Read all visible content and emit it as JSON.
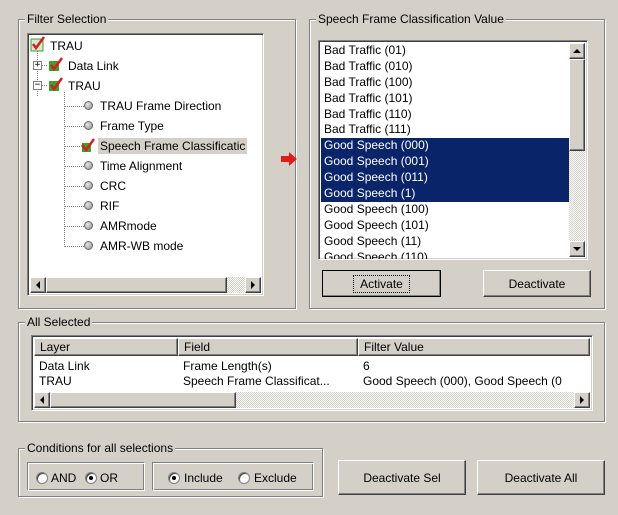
{
  "filter_selection": {
    "title": "Filter Selection",
    "tree": {
      "root": "TRAU",
      "data_link": "Data Link",
      "trau": "TRAU",
      "children": [
        "TRAU Frame Direction",
        "Frame Type",
        "Speech Frame Classificatic",
        "Time Alignment",
        "CRC",
        "RIF",
        "AMRmode",
        "AMR-WB mode"
      ],
      "selected_index": 2,
      "expand_plus": "+",
      "expand_minus": "−"
    }
  },
  "value_panel": {
    "title": "Speech Frame Classification Value",
    "items": [
      {
        "label": "Bad Traffic (01)",
        "selected": false
      },
      {
        "label": "Bad Traffic (010)",
        "selected": false
      },
      {
        "label": "Bad Traffic (100)",
        "selected": false
      },
      {
        "label": "Bad Traffic (101)",
        "selected": false
      },
      {
        "label": "Bad Traffic (110)",
        "selected": false
      },
      {
        "label": "Bad Traffic (111)",
        "selected": false
      },
      {
        "label": "Good Speech (000)",
        "selected": true
      },
      {
        "label": "Good Speech (001)",
        "selected": true
      },
      {
        "label": "Good Speech (011)",
        "selected": true
      },
      {
        "label": "Good Speech (1)",
        "selected": true
      },
      {
        "label": "Good Speech (100)",
        "selected": false
      },
      {
        "label": "Good Speech (101)",
        "selected": false
      },
      {
        "label": "Good Speech (11)",
        "selected": false
      },
      {
        "label": "Good Speech (110)",
        "selected": false
      }
    ],
    "activate_label": "Activate",
    "deactivate_label": "Deactivate"
  },
  "all_selected": {
    "title": "All Selected",
    "columns": [
      "Layer",
      "Field",
      "Filter Value"
    ],
    "rows": [
      [
        "Data Link",
        "Frame Length(s)",
        "6"
      ],
      [
        "TRAU",
        "Speech Frame Classificat...",
        "Good Speech (000), Good Speech (0"
      ]
    ]
  },
  "conditions": {
    "title": "Conditions for all selections",
    "and_label": "AND",
    "or_label": "OR",
    "logic_selected": "OR",
    "include_label": "Include",
    "exclude_label": "Exclude",
    "mode_selected": "Include"
  },
  "buttons": {
    "deactivate_sel": "Deactivate Sel",
    "deactivate_all": "Deactivate All"
  },
  "colors": {
    "face": "#d4d0c8",
    "selection": "#0a246a",
    "arrow": "#e11b1b",
    "check": "#d42020",
    "check_green": "#3aa12a"
  }
}
